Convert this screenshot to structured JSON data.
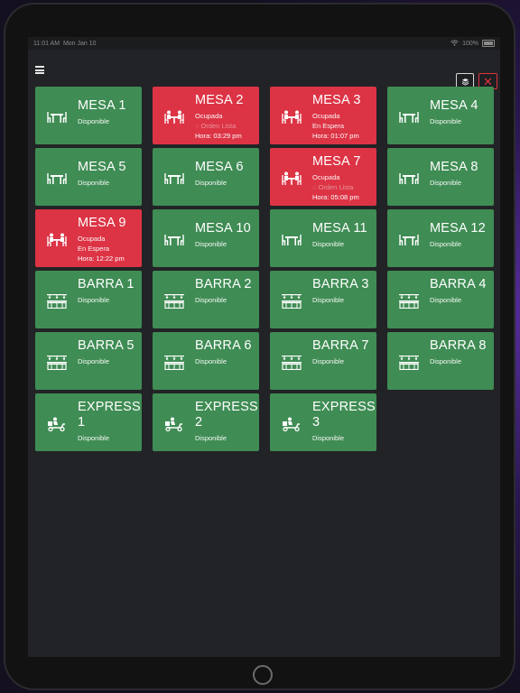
{
  "statusbar": {
    "time": "11:01 AM",
    "date": "Mon Jan 10",
    "battery": "100%"
  },
  "colors": {
    "available": "#3f8c54",
    "occupied": "#dc3445"
  },
  "tables": [
    {
      "title": "MESA 1",
      "status": "Disponible",
      "state": "available",
      "icon": "dining-table-icon"
    },
    {
      "title": "MESA 2",
      "status": "Ocupada",
      "order": "◌ Orden Lista",
      "order_muted": true,
      "hora": "Hora: 03:29 pm",
      "state": "occupied",
      "icon": "people-at-table-icon"
    },
    {
      "title": "MESA 3",
      "status": "Ocupada",
      "order": "En Espera",
      "order_muted": false,
      "hora": "Hora: 01:07 pm",
      "state": "occupied",
      "icon": "people-at-table-icon"
    },
    {
      "title": "MESA 4",
      "status": "Disponible",
      "state": "available",
      "icon": "dining-table-icon"
    },
    {
      "title": "MESA 5",
      "status": "Disponible",
      "state": "available",
      "icon": "dining-table-icon"
    },
    {
      "title": "MESA 6",
      "status": "Disponible",
      "state": "available",
      "icon": "dining-table-icon"
    },
    {
      "title": "MESA 7",
      "status": "Ocupada",
      "order": "◌ Orden Lista",
      "order_muted": true,
      "hora": "Hora: 05:08 pm",
      "state": "occupied",
      "icon": "people-at-table-icon"
    },
    {
      "title": "MESA 8",
      "status": "Disponible",
      "state": "available",
      "icon": "dining-table-icon"
    },
    {
      "title": "MESA 9",
      "status": "Ocupada",
      "order": "En Espera",
      "order_muted": false,
      "hora": "Hora: 12:22 pm",
      "state": "occupied",
      "icon": "people-at-table-icon"
    },
    {
      "title": "MESA 10",
      "status": "Disponible",
      "state": "available",
      "icon": "dining-table-icon"
    },
    {
      "title": "MESA 11",
      "status": "Disponible",
      "state": "available",
      "icon": "dining-table-icon"
    },
    {
      "title": "MESA 12",
      "status": "Disponible",
      "state": "available",
      "icon": "dining-table-icon"
    },
    {
      "title": "BARRA 1",
      "status": "Disponible",
      "state": "available",
      "icon": "bar-counter-icon"
    },
    {
      "title": "BARRA 2",
      "status": "Disponible",
      "state": "available",
      "icon": "bar-counter-icon"
    },
    {
      "title": "BARRA 3",
      "status": "Disponible",
      "state": "available",
      "icon": "bar-counter-icon"
    },
    {
      "title": "BARRA 4",
      "status": "Disponible",
      "state": "available",
      "icon": "bar-counter-icon"
    },
    {
      "title": "BARRA 5",
      "status": "Disponible",
      "state": "available",
      "icon": "bar-counter-icon"
    },
    {
      "title": "BARRA 6",
      "status": "Disponible",
      "state": "available",
      "icon": "bar-counter-icon"
    },
    {
      "title": "BARRA 7",
      "status": "Disponible",
      "state": "available",
      "icon": "bar-counter-icon"
    },
    {
      "title": "BARRA 8",
      "status": "Disponible",
      "state": "available",
      "icon": "bar-counter-icon"
    },
    {
      "title": "EXPRESS 1",
      "status": "Disponible",
      "state": "available",
      "icon": "delivery-scooter-icon"
    },
    {
      "title": "EXPRESS 2",
      "status": "Disponible",
      "state": "available",
      "icon": "delivery-scooter-icon"
    },
    {
      "title": "EXPRESS 3",
      "status": "Disponible",
      "state": "available",
      "icon": "delivery-scooter-icon"
    }
  ]
}
